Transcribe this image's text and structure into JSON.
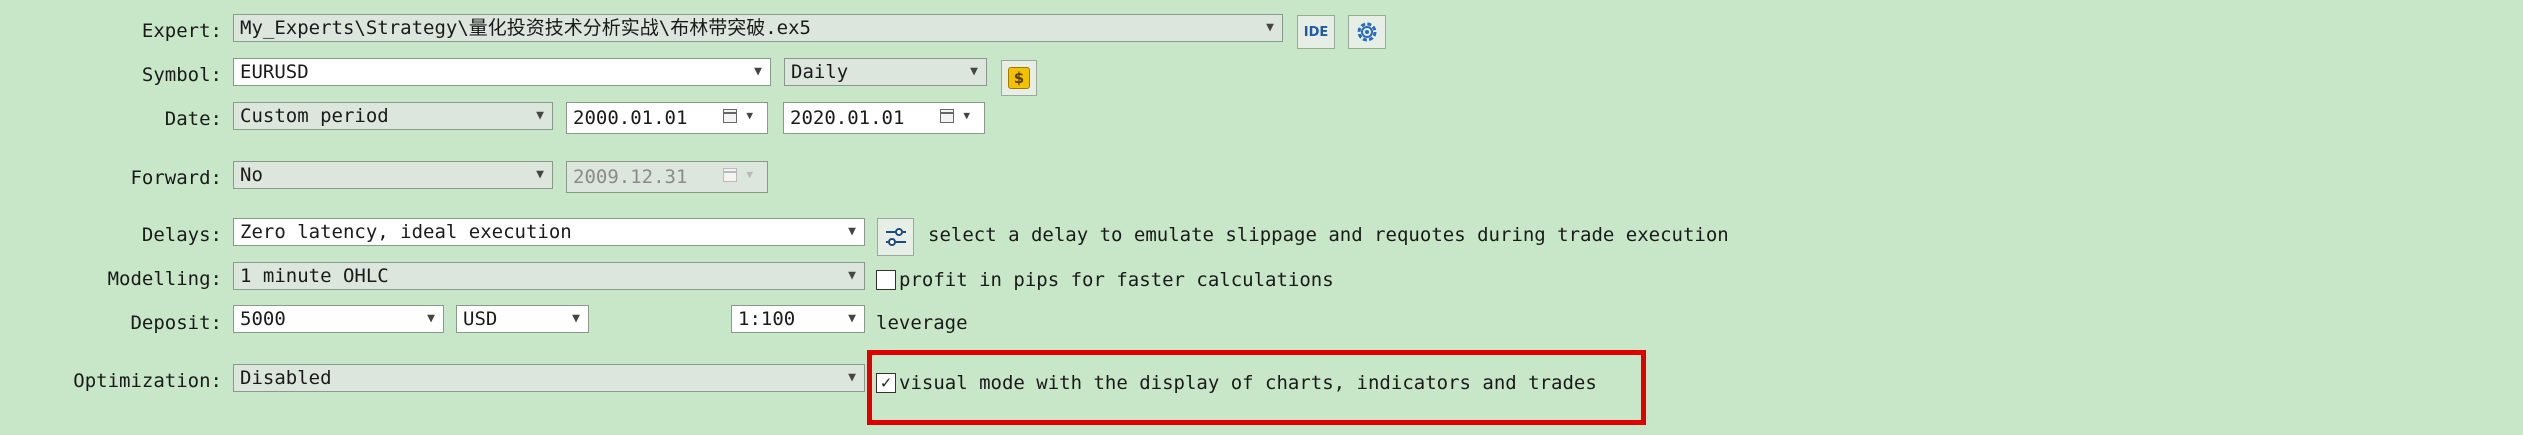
{
  "labels": {
    "expert": "Expert:",
    "symbol": "Symbol:",
    "date": "Date:",
    "forward": "Forward:",
    "delays": "Delays:",
    "modelling": "Modelling:",
    "deposit": "Deposit:",
    "optimization": "Optimization:"
  },
  "expert": {
    "value": "My_Experts\\Strategy\\量化投资技术分析实战\\布林带突破.ex5",
    "ide_label": "IDE"
  },
  "symbol": {
    "value": "EURUSD",
    "timeframe": "Daily"
  },
  "date": {
    "mode": "Custom period",
    "from": "2000.01.01",
    "to": "2020.01.01"
  },
  "forward": {
    "mode": "No",
    "date": "2009.12.31"
  },
  "delays": {
    "value": "Zero latency, ideal execution",
    "hint": "select a delay to emulate slippage and requotes during trade execution"
  },
  "modelling": {
    "value": "1 minute OHLC",
    "pips_label": "profit in pips for faster calculations",
    "pips_checked": false
  },
  "deposit": {
    "amount": "5000",
    "currency": "USD",
    "leverage": "1:100",
    "leverage_label": "leverage"
  },
  "optimization": {
    "value": "Disabled",
    "visual_label": "visual mode with the display of charts, indicators and trades",
    "visual_checked": true
  },
  "colors": {
    "background": "#c8e6c8",
    "highlight": "#e00000",
    "coin": "#f2c200"
  },
  "icons": [
    "chevron-down-icon",
    "gear-icon",
    "dollar-coin-icon",
    "calendar-icon",
    "sliders-icon",
    "checkmark-icon"
  ]
}
